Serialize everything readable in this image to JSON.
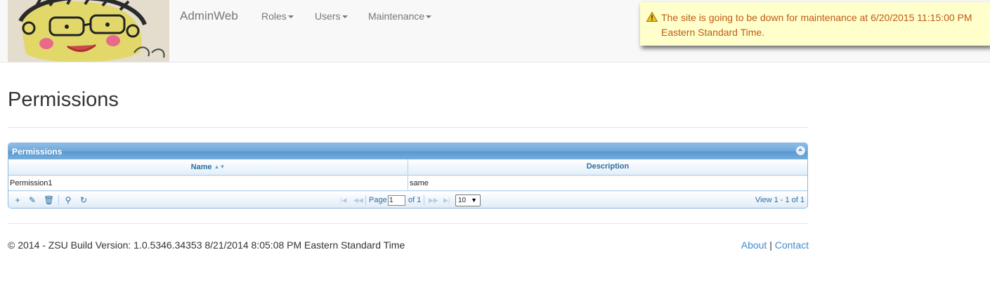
{
  "navbar": {
    "brand": "AdminWeb",
    "menus": [
      {
        "label": "Roles"
      },
      {
        "label": "Users"
      },
      {
        "label": "Maintenance"
      }
    ]
  },
  "notice": {
    "text": "The site is going to be down for maintenance at 6/20/2015 11:15:00 PM Eastern Standard Time.",
    "icon": "warning-icon",
    "color": "#c05a16",
    "background": "#ffffcc"
  },
  "page": {
    "title": "Permissions"
  },
  "grid": {
    "caption": "Permissions",
    "columns": [
      "Name",
      "Description"
    ],
    "rows": [
      {
        "name": "Permission1",
        "description": "same"
      }
    ],
    "pager": {
      "page_label": "Page",
      "page_value": "1",
      "of_label": "of 1",
      "rows_per_page": "10",
      "view_info": "View 1 - 1 of 1"
    }
  },
  "footer": {
    "text": "© 2014 - ZSU Build Version: 1.0.5346.34353 8/21/2014 8:05:08 PM Eastern Standard Time",
    "about": "About",
    "separator": "|",
    "contact": "Contact"
  }
}
